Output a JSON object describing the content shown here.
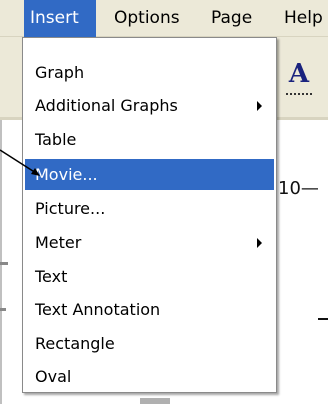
{
  "menubar": {
    "items": [
      {
        "label": "Insert",
        "active": true
      },
      {
        "label": "Options",
        "active": false
      },
      {
        "label": "Page",
        "active": false
      },
      {
        "label": "Help",
        "active": false
      }
    ]
  },
  "canvas": {
    "fragment_text": "10—"
  },
  "insert_menu": {
    "items": [
      {
        "label": "Graph",
        "has_submenu": false,
        "selected": false
      },
      {
        "label": "Additional Graphs",
        "has_submenu": true,
        "selected": false
      },
      {
        "label": "Table",
        "has_submenu": false,
        "selected": false
      },
      {
        "label": "Movie...",
        "has_submenu": false,
        "selected": true
      },
      {
        "label": "Picture...",
        "has_submenu": false,
        "selected": false
      },
      {
        "label": "Meter",
        "has_submenu": true,
        "selected": false
      },
      {
        "label": "Text",
        "has_submenu": false,
        "selected": false
      },
      {
        "label": "Text Annotation",
        "has_submenu": false,
        "selected": false
      },
      {
        "label": "Rectangle",
        "has_submenu": false,
        "selected": false
      },
      {
        "label": "Oval",
        "has_submenu": false,
        "selected": false
      }
    ]
  },
  "colors": {
    "menu_highlight": "#316AC5",
    "menubar_bg": "#ECE9D8"
  }
}
